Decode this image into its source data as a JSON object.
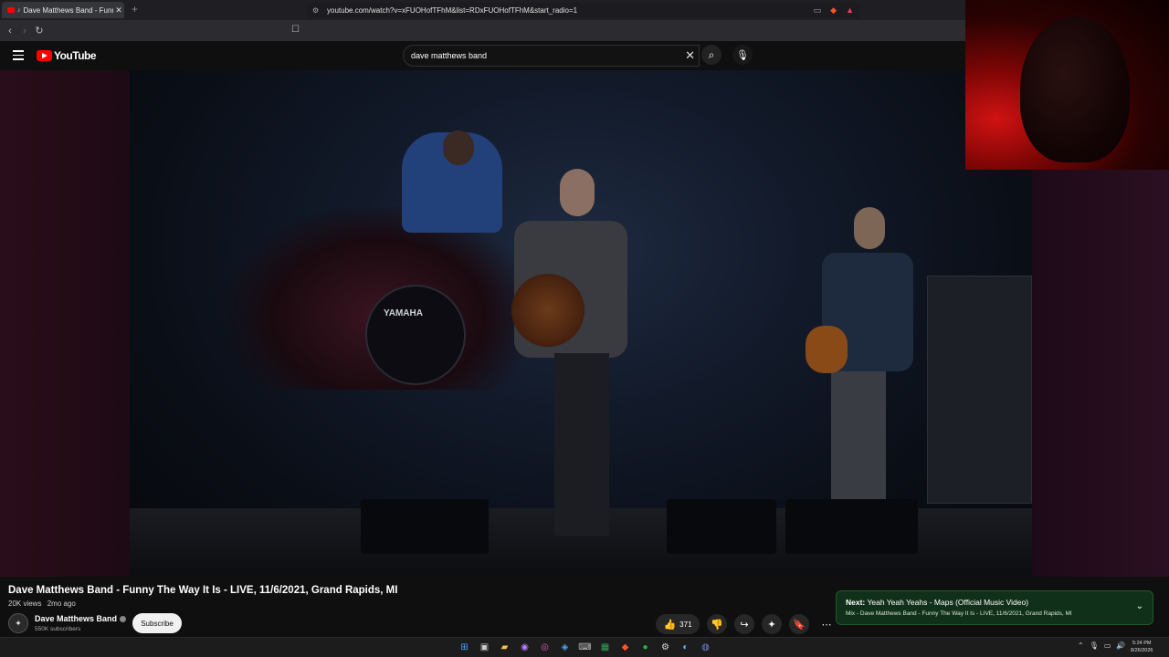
{
  "browser": {
    "tab_title": "Dave Matthews Band - Funny",
    "url": "youtube.com/watch?v=xFUOHofTFhM&list=RDxFUOHofTFhM&start_radio=1"
  },
  "youtube": {
    "logo_text": "YouTube",
    "search_value": "dave matthews band"
  },
  "video": {
    "bass_drum_text": "YAMAHA",
    "title": "Dave Matthews Band - Funny The Way It Is - LIVE, 11/6/2021, Grand Rapids, MI",
    "views": "20K views",
    "age": "2mo ago",
    "channel": "Dave Matthews Band",
    "subscribers": "550K subscribers",
    "subscribe_label": "Subscribe",
    "like_count": "371"
  },
  "next_up": {
    "label": "Next:",
    "title": "Yeah Yeah Yeahs - Maps (Official Music Video)",
    "subtitle": "Mix - Dave Matthews Band - Funny The Way It Is - LIVE, 11/6/2021, Grand Rapids, MI"
  },
  "taskbar": {
    "time": "5:24 PM",
    "date": "8/26/2026"
  },
  "colors": {
    "youtube_red": "#ff0000",
    "next_bg": "#11301a"
  }
}
